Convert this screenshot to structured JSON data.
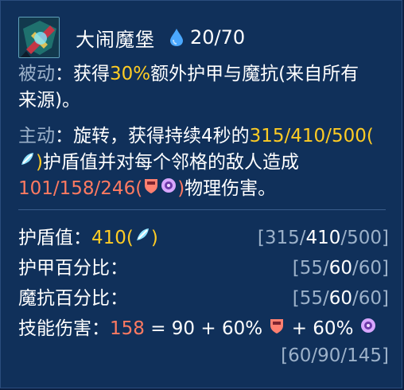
{
  "skill": {
    "name": "大闹魔堡",
    "mana_cost": "20/70"
  },
  "passive": {
    "label": "被动",
    "colon": "：",
    "text_before": "获得",
    "value": "30%",
    "text_after": "额外护甲与魔抗(来自所有",
    "text_line2": "来源)。"
  },
  "active": {
    "label": "主动",
    "colon": "：",
    "text_before": "旋转，获得持续4秒的",
    "shield_values": "315/410/500",
    "open_paren": "(",
    "close_paren": ")",
    "text_middle": "护盾值并对每个邻格的敌人造成",
    "damage_values": "101/158/246",
    "text_end": "物理伤害。"
  },
  "stats": [
    {
      "label": "护盾值：",
      "value": "410",
      "bracket_parts": [
        "[315/",
        "410",
        "/500]"
      ]
    },
    {
      "label": "护甲百分比：",
      "bracket_parts": [
        "[55/",
        "60",
        "/60]"
      ]
    },
    {
      "label": "魔抗百分比：",
      "bracket_parts": [
        "[55/",
        "60",
        "/60]"
      ]
    },
    {
      "label": "技能伤害：",
      "value": "158",
      "formula_a": " = 90 + 60% ",
      "formula_b": " + 60% ",
      "bracket": "[60/90/145]"
    }
  ],
  "icons": {
    "skill": "spinning-castle-ability-icon",
    "mana": "mana-drop-icon",
    "shield": "shield-scaling-icon",
    "armor": "armor-icon",
    "magic_resist": "magic-resist-icon"
  },
  "colors": {
    "background": "#10305a",
    "highlight_yellow": "#ffcc24",
    "damage_red": "#ff7a61",
    "label_gray": "#9cb1c9"
  }
}
